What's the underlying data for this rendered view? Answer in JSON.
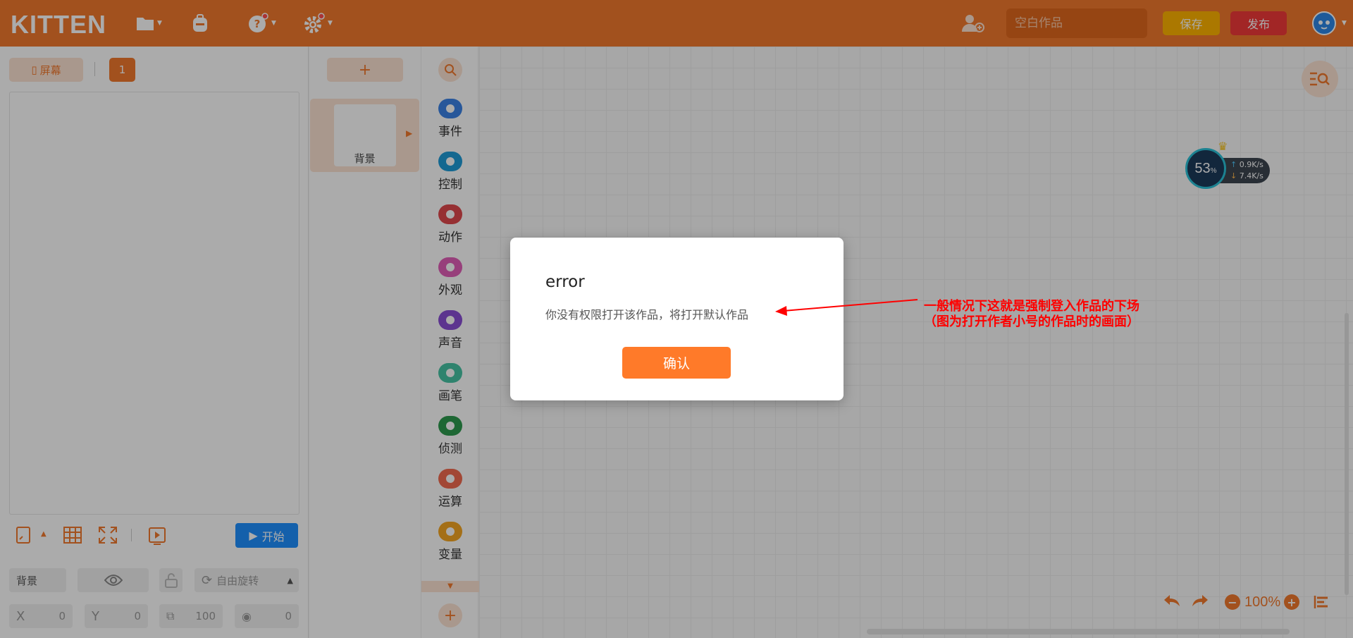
{
  "header": {
    "logo": "KITTEN",
    "title_placeholder": "空白作品",
    "save_label": "保存",
    "publish_label": "发布"
  },
  "stage_panel": {
    "screen_tab_label": "屏幕",
    "screen_number": "1",
    "start_label": "开始",
    "sprite_name": "背景",
    "rotation_label": "自由旋转",
    "x_label": "X",
    "x_value": "0",
    "y_label": "Y",
    "y_value": "0",
    "size_value": "100",
    "direction_value": "0"
  },
  "sprite_list": {
    "add_label": "+",
    "items": [
      {
        "label": "背景"
      }
    ]
  },
  "categories": [
    {
      "label": "事件",
      "color": "#3b82e6",
      "icon": "toggle-icon"
    },
    {
      "label": "控制",
      "color": "#1e9bd7",
      "icon": "gamepad-icon"
    },
    {
      "label": "动作",
      "color": "#e0484d",
      "icon": "robot-icon"
    },
    {
      "label": "外观",
      "color": "#e25fb8",
      "icon": "shirt-icon"
    },
    {
      "label": "声音",
      "color": "#8a4ed6",
      "icon": "music-icon"
    },
    {
      "label": "画笔",
      "color": "#46c4a4",
      "icon": "brush-icon"
    },
    {
      "label": "侦测",
      "color": "#2e9a4e",
      "icon": "radar-icon"
    },
    {
      "label": "运算",
      "color": "#f26b4f",
      "icon": "math-icon"
    },
    {
      "label": "变量",
      "color": "#f5a623",
      "icon": "variable-icon"
    }
  ],
  "workspace": {
    "zoom": "100%",
    "net_monitor": {
      "percent": "53",
      "percent_unit": "%",
      "upload": "0.9K/s",
      "download": "7.4K/s"
    }
  },
  "dialog": {
    "title": "error",
    "message": "你没有权限打开该作品，将打开默认作品",
    "confirm_label": "确认"
  },
  "annotation": {
    "line1": "一般情况下这就是强制登入作品的下场",
    "line2": "（图为打开作者小号的作品时的画面）",
    "color": "#ff0000"
  },
  "colors": {
    "brand": "#f2792d",
    "save": "#ffb400",
    "publish": "#f23a3a",
    "start": "#1e90ff"
  }
}
